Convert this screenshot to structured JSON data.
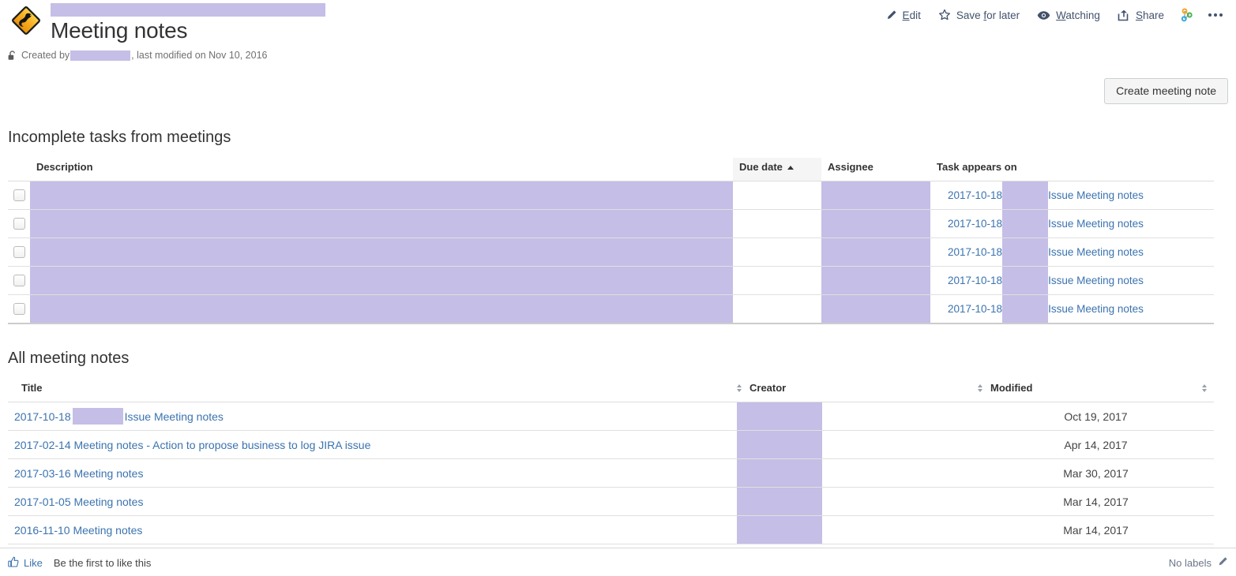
{
  "header": {
    "space_logo_icon": "kangaroo-crossing-sign-icon",
    "breadcrumb_redacted": "",
    "title": "Meeting notes",
    "byline_lock_icon": "unlocked-padlock-icon",
    "byline_prefix": "Created by",
    "byline_author_redacted": "",
    "byline_suffix": ", last modified on Nov 10, 2016"
  },
  "toolbar": {
    "items": [
      {
        "icon": "pencil-icon",
        "label": "Edit",
        "underline_char": "E"
      },
      {
        "icon": "star-icon",
        "label": "Save for later",
        "underline_char": "f"
      },
      {
        "icon": "eye-icon",
        "label": "Watching",
        "underline_char": "W"
      },
      {
        "icon": "share-arrow-icon",
        "label": "Share",
        "underline_char": "S"
      }
    ],
    "network_icon": "network-graph-icon",
    "more_icon": "more-options-icon"
  },
  "actions": {
    "create_meeting_note": "Create meeting note"
  },
  "tasks_section": {
    "heading": "Incomplete tasks from meetings",
    "columns": {
      "checkbox": "",
      "description": "Description",
      "due_date": "Due date",
      "assignee": "Assignee",
      "task_appears_on": "Task appears on"
    },
    "sorted_column": "Due date",
    "sort_direction": "ascending",
    "rows": [
      {
        "checked": false,
        "description_redacted": "",
        "due_date": "",
        "assignee_redacted": "",
        "appears_date": "2017-10-18",
        "appears_redacted": "",
        "appears_label": "Issue Meeting notes"
      },
      {
        "checked": false,
        "description_redacted": "",
        "due_date": "",
        "assignee_redacted": "",
        "appears_date": "2017-10-18",
        "appears_redacted": "",
        "appears_label": "Issue Meeting notes"
      },
      {
        "checked": false,
        "description_redacted": "",
        "due_date": "",
        "assignee_redacted": "",
        "appears_date": "2017-10-18",
        "appears_redacted": "",
        "appears_label": "Issue Meeting notes"
      },
      {
        "checked": false,
        "description_redacted": "",
        "due_date": "",
        "assignee_redacted": "",
        "appears_date": "2017-10-18",
        "appears_redacted": "",
        "appears_label": "Issue Meeting notes"
      },
      {
        "checked": false,
        "description_redacted": "",
        "due_date": "",
        "assignee_redacted": "",
        "appears_date": "2017-10-18",
        "appears_redacted": "",
        "appears_label": "Issue Meeting notes"
      }
    ]
  },
  "notes_section": {
    "heading": "All meeting notes",
    "columns": {
      "title": "Title",
      "creator": "Creator",
      "modified": "Modified"
    },
    "rows": [
      {
        "title_prefix": "2017-10-18",
        "title_redacted": "",
        "title_suffix": "Issue Meeting notes",
        "creator_redacted": "",
        "modified": "Oct 19, 2017"
      },
      {
        "title_prefix": "",
        "title_redacted": null,
        "title_suffix": "2017-02-14 Meeting notes - Action to propose business to log JIRA issue",
        "creator_redacted": "",
        "modified": "Apr 14, 2017"
      },
      {
        "title_prefix": "",
        "title_redacted": null,
        "title_suffix": "2017-03-16 Meeting notes",
        "creator_redacted": "",
        "modified": "Mar 30, 2017"
      },
      {
        "title_prefix": "",
        "title_redacted": null,
        "title_suffix": "2017-01-05 Meeting notes",
        "creator_redacted": "",
        "modified": "Mar 14, 2017"
      },
      {
        "title_prefix": "",
        "title_redacted": null,
        "title_suffix": "2016-11-10 Meeting notes",
        "creator_redacted": "",
        "modified": "Mar 14, 2017"
      }
    ]
  },
  "footer": {
    "like_icon": "thumbs-up-icon",
    "like_label": "Like",
    "like_status": "Be the first to like this",
    "labels_text": "No labels",
    "labels_edit_icon": "pencil-icon"
  },
  "colors": {
    "redaction": "#c5bee6",
    "link": "#3b73af",
    "logo_orange": "#f5a623",
    "toolbar_text": "#42526e"
  }
}
